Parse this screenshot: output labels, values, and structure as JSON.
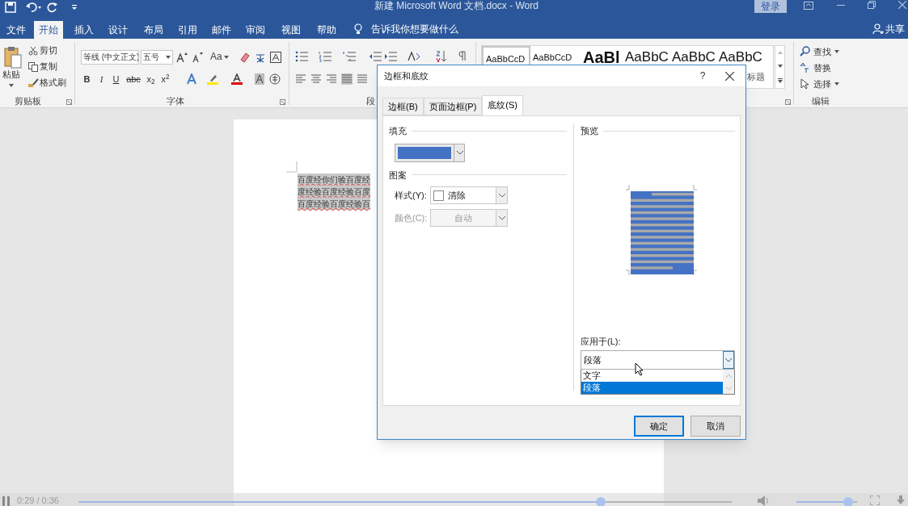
{
  "window": {
    "title": "新建 Microsoft Word 文档.docx  -  Word",
    "sign_in": "登录",
    "share": "共享"
  },
  "menu_tabs": [
    {
      "label": "文件",
      "selected": false
    },
    {
      "label": "开始",
      "selected": true
    },
    {
      "label": "插入",
      "selected": false
    },
    {
      "label": "设计",
      "selected": false
    },
    {
      "label": "布局",
      "selected": false
    },
    {
      "label": "引用",
      "selected": false
    },
    {
      "label": "邮件",
      "selected": false
    },
    {
      "label": "审阅",
      "selected": false
    },
    {
      "label": "视图",
      "selected": false
    },
    {
      "label": "帮助",
      "selected": false
    }
  ],
  "tell_me": "告诉我你想要做什么",
  "ribbon": {
    "clipboard": {
      "paste": "粘贴",
      "cut": "剪切",
      "copy": "复制",
      "format_painter": "格式刷",
      "label": "剪贴板"
    },
    "font": {
      "name": "等线 (中文正文)",
      "size": "五号",
      "change_case": "Aa",
      "label": "字体",
      "buttons": [
        {
          "kind": "bold",
          "label": "B"
        },
        {
          "kind": "italic",
          "label": "I"
        },
        {
          "kind": "underline",
          "label": "U"
        },
        {
          "kind": "strike",
          "label": "abc"
        },
        {
          "kind": "sub",
          "label": "x$_{2}$"
        },
        {
          "kind": "sup",
          "label": "x$^{2}$"
        }
      ]
    },
    "paragraph": {
      "label": "段"
    },
    "styles": [
      {
        "label": "AaBbCcD",
        "selected": true,
        "kind": "normal"
      },
      {
        "label": "AaBbCcD",
        "selected": false,
        "kind": "normal"
      },
      {
        "label": "AaBl",
        "selected": false,
        "kind": "big"
      },
      {
        "label": "AaBbC",
        "selected": false,
        "kind": "heading"
      },
      {
        "label": "AaBbC",
        "selected": false,
        "kind": "heading"
      },
      {
        "label": "AaBbC",
        "selected": false,
        "kind": "heading"
      }
    ],
    "styles_caption": "标题",
    "editing": {
      "items": [
        "查找",
        "替换",
        "选择"
      ],
      "label": "编辑"
    }
  },
  "document": {
    "lines": [
      "百度经你们验百度经",
      "度经验百度经验百度",
      "百度经验百度经验百"
    ]
  },
  "dialog": {
    "title": "边框和底纹",
    "help": "?",
    "tabs": [
      {
        "label": "边框(B)",
        "selected": false
      },
      {
        "label": "页面边框(P)",
        "selected": false
      },
      {
        "label": "底纹(S)",
        "selected": true
      }
    ],
    "fill": {
      "label": "填充",
      "color": "#4472c4"
    },
    "pattern_label": "图案",
    "style_label": "样式(Y):",
    "style_value": "清除",
    "color_label": "颜色(C):",
    "color_value": "自动",
    "color_disabled": true,
    "preview_label": "预览",
    "apply_label": "应用于(L):",
    "apply_value": "段落",
    "apply_options": [
      {
        "label": "文字",
        "selected": false
      },
      {
        "label": "段落",
        "selected": true
      }
    ],
    "buttons": [
      {
        "label": "确定",
        "default": true
      },
      {
        "label": "取消",
        "default": false
      }
    ]
  },
  "player": {
    "time": "0:29 / 0:36",
    "progress": {
      "level": 0.8
    },
    "volume": {
      "level": 0.85
    }
  }
}
